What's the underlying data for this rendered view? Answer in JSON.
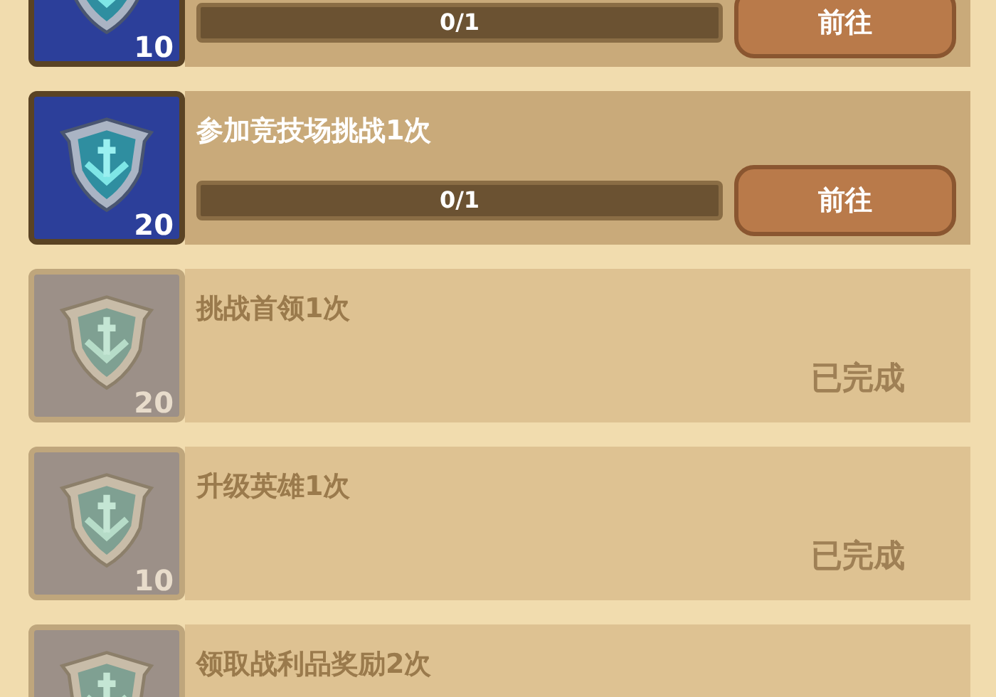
{
  "tasks": [
    {
      "count": "10",
      "completed": false,
      "progress": "0/1",
      "level": 0,
      "button": "前往"
    },
    {
      "title": "参加竞技场挑战1次",
      "count": "20",
      "completed": false,
      "progress": "0/1",
      "level": 0,
      "button": "前往"
    },
    {
      "title": "挑战首领1次",
      "count": "20",
      "completed": true,
      "status": "已完成"
    },
    {
      "title": "升级英雄1次",
      "count": "10",
      "completed": true,
      "status": "已完成"
    },
    {
      "title": "领取战利品奖励2次",
      "completed": true
    }
  ]
}
